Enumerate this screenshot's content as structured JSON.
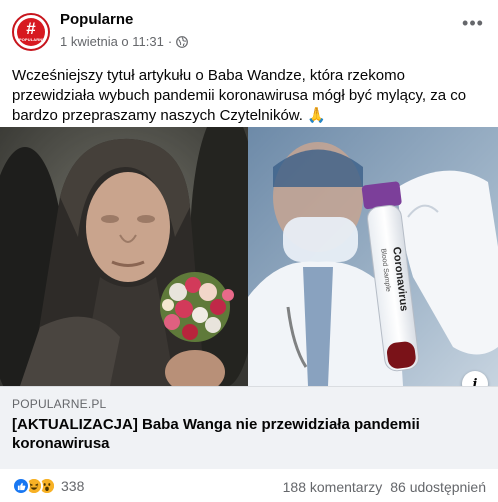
{
  "post": {
    "page_name": "Popularne",
    "avatar_symbol": "#",
    "avatar_text": "POPULARNE",
    "timestamp": "1 kwietnia o 11:31",
    "separator": "·",
    "privacy_icon": "globe-icon",
    "more_icon": "more-options-icon",
    "text": "Wcześniejszy tytuł artykułu o Baba Wandze, która rzekomo przewidziała wybuch pandemii koronawirusa mógł być mylący, za co bardzo przepraszamy naszych Czytelników. 🙏"
  },
  "link_preview": {
    "domain": "POPULARNE.PL",
    "title": "[AKTUALIZACJA] Baba Wanga nie przewidziała pandemii koronawirusa",
    "image_left_alt": "Starsza kobieta w chuście z bukietem kwiatów",
    "image_right_tube_text": "Coronavirus",
    "image_right_tube_subtext": "Blood Sample",
    "info_icon": "i"
  },
  "engagement": {
    "reactions": [
      "like",
      "haha",
      "wow"
    ],
    "reaction_count": "338",
    "comments": "188 komentarzy",
    "shares": "86 udostępnień"
  },
  "colors": {
    "brand_red": "#d71920",
    "like_blue": "#1877f2",
    "secondary_text": "#65676b",
    "link_bg": "#f0f2f5"
  }
}
